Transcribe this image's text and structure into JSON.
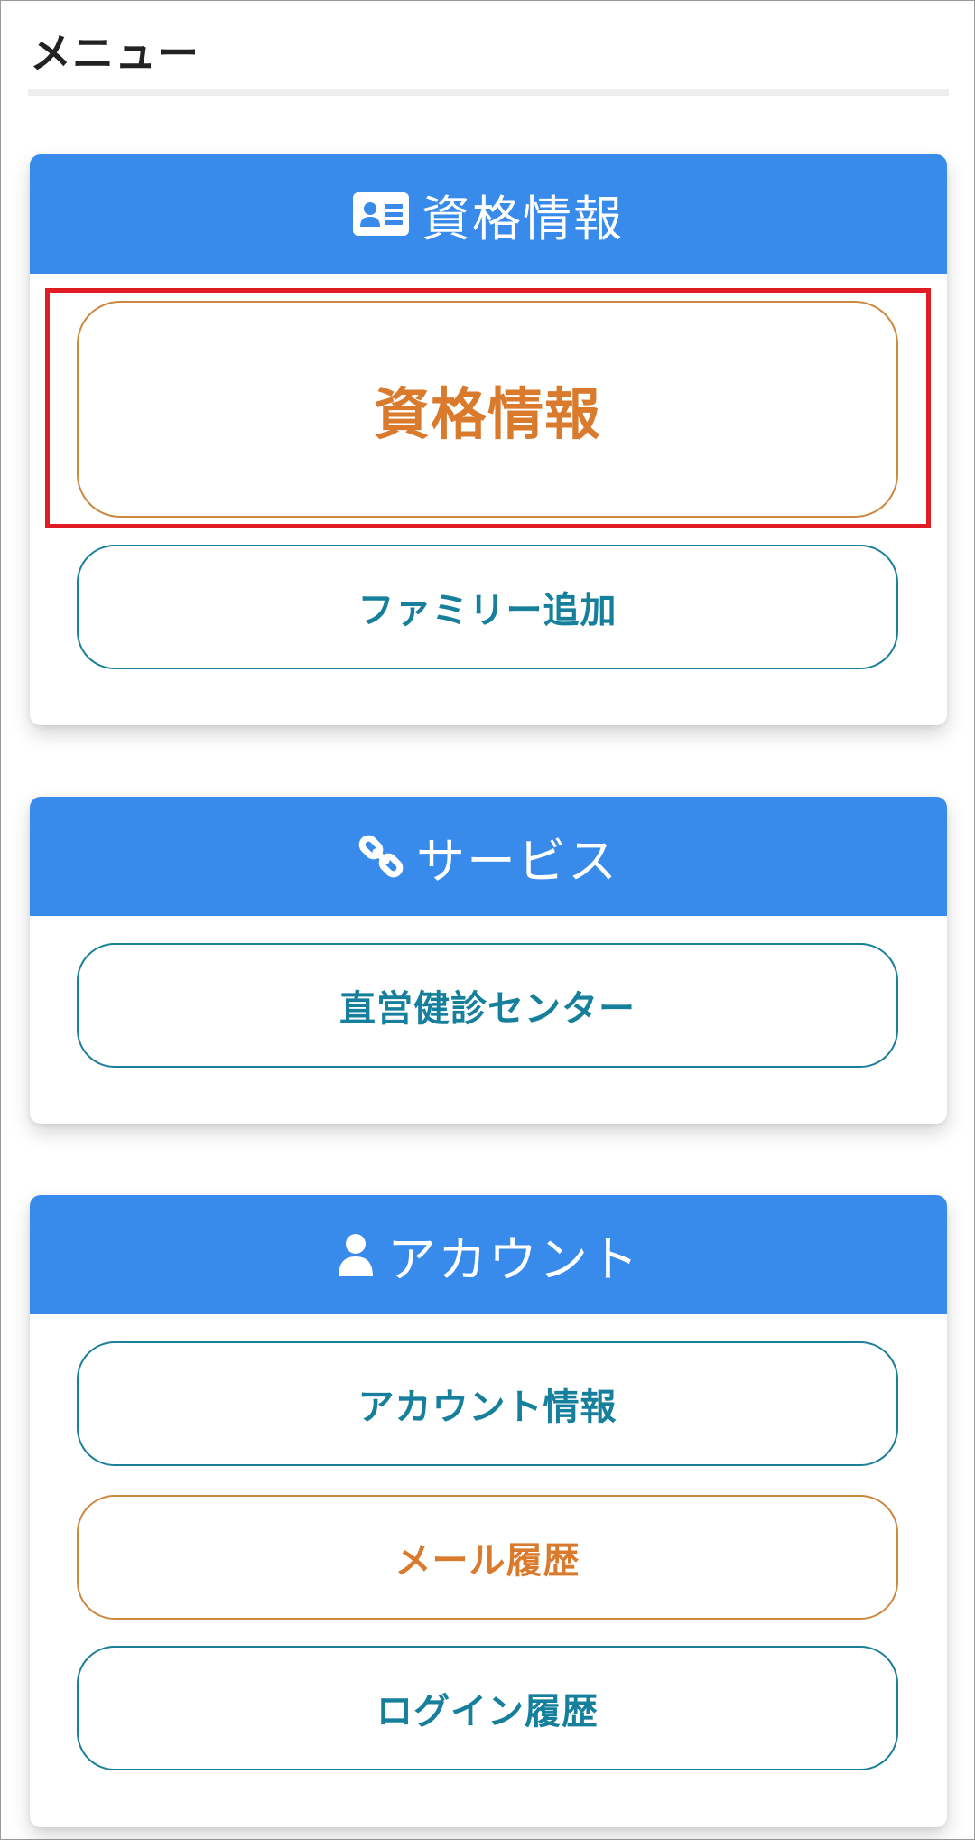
{
  "page": {
    "title": "メニュー"
  },
  "colors": {
    "header_blue": "#388beb",
    "teal_text": "#16809c",
    "orange_text": "#d97a2d",
    "highlight_red": "#e01b22"
  },
  "sections": [
    {
      "icon": "id-card-icon",
      "header": "資格情報",
      "buttons": [
        {
          "label": "資格情報",
          "style": "orange",
          "highlighted": true
        },
        {
          "label": "ファミリー追加",
          "style": "teal"
        }
      ]
    },
    {
      "icon": "link-icon",
      "header": "サービス",
      "buttons": [
        {
          "label": "直営健診センター",
          "style": "teal"
        }
      ]
    },
    {
      "icon": "user-icon",
      "header": "アカウント",
      "buttons": [
        {
          "label": "アカウント情報",
          "style": "teal"
        },
        {
          "label": "メール履歴",
          "style": "orange"
        },
        {
          "label": "ログイン履歴",
          "style": "teal"
        }
      ]
    }
  ]
}
